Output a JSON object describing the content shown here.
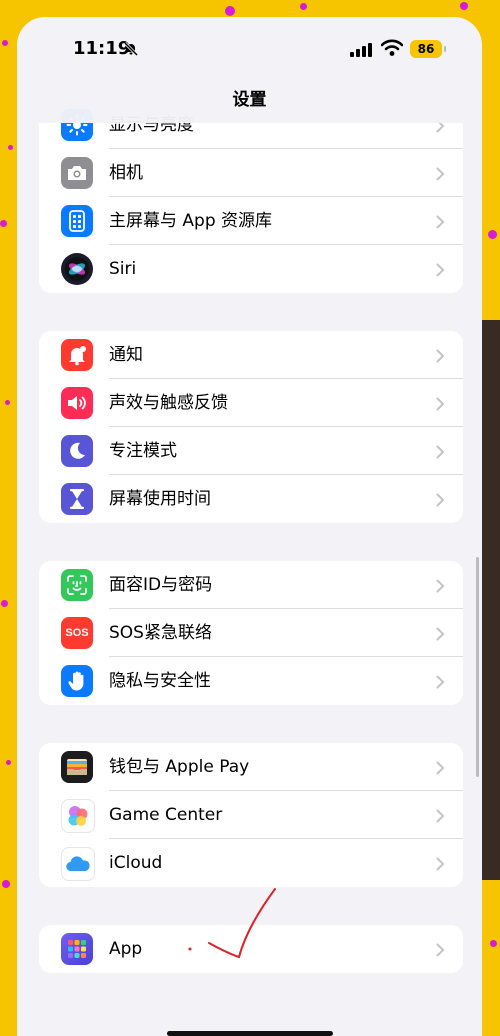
{
  "status_bar": {
    "time": "11:19",
    "battery": "86"
  },
  "nav": {
    "title": "设置"
  },
  "groups": [
    {
      "items": [
        {
          "label": "显示与亮度",
          "icon": "sun-icon",
          "color": "#0a7aff"
        },
        {
          "label": "相机",
          "icon": "camera-icon",
          "color": "#8e8e93"
        },
        {
          "label": "主屏幕与 App 资源库",
          "icon": "home-screen-icon",
          "color": "#0a7aff"
        },
        {
          "label": "Siri",
          "icon": "siri-icon",
          "color": "#1b1b2f"
        }
      ]
    },
    {
      "items": [
        {
          "label": "通知",
          "icon": "bell-icon",
          "color": "#ff3b30"
        },
        {
          "label": "声效与触感反馈",
          "icon": "speaker-icon",
          "color": "#ff2d55"
        },
        {
          "label": "专注模式",
          "icon": "moon-icon",
          "color": "#5856d6"
        },
        {
          "label": "屏幕使用时间",
          "icon": "hourglass-icon",
          "color": "#5856d6"
        }
      ]
    },
    {
      "items": [
        {
          "label": "面容ID与密码",
          "icon": "face-id-icon",
          "color": "#34c759"
        },
        {
          "label": "SOS紧急联络",
          "icon": "sos-icon",
          "color": "#ff3b30",
          "icon_text": "SOS"
        },
        {
          "label": "隐私与安全性",
          "icon": "hand-icon",
          "color": "#0a7aff"
        }
      ]
    },
    {
      "items": [
        {
          "label": "钱包与 Apple Pay",
          "icon": "wallet-icon",
          "color": "#1c1c1e"
        },
        {
          "label": "Game Center",
          "icon": "game-center-icon",
          "color": "#ffffff"
        },
        {
          "label": "iCloud",
          "icon": "icloud-icon",
          "color": "#ffffff"
        }
      ]
    },
    {
      "items": [
        {
          "label": "App",
          "icon": "app-grid-icon",
          "color": "#5e5ce6"
        }
      ]
    }
  ],
  "annotation": {
    "color": "#e0222a"
  }
}
